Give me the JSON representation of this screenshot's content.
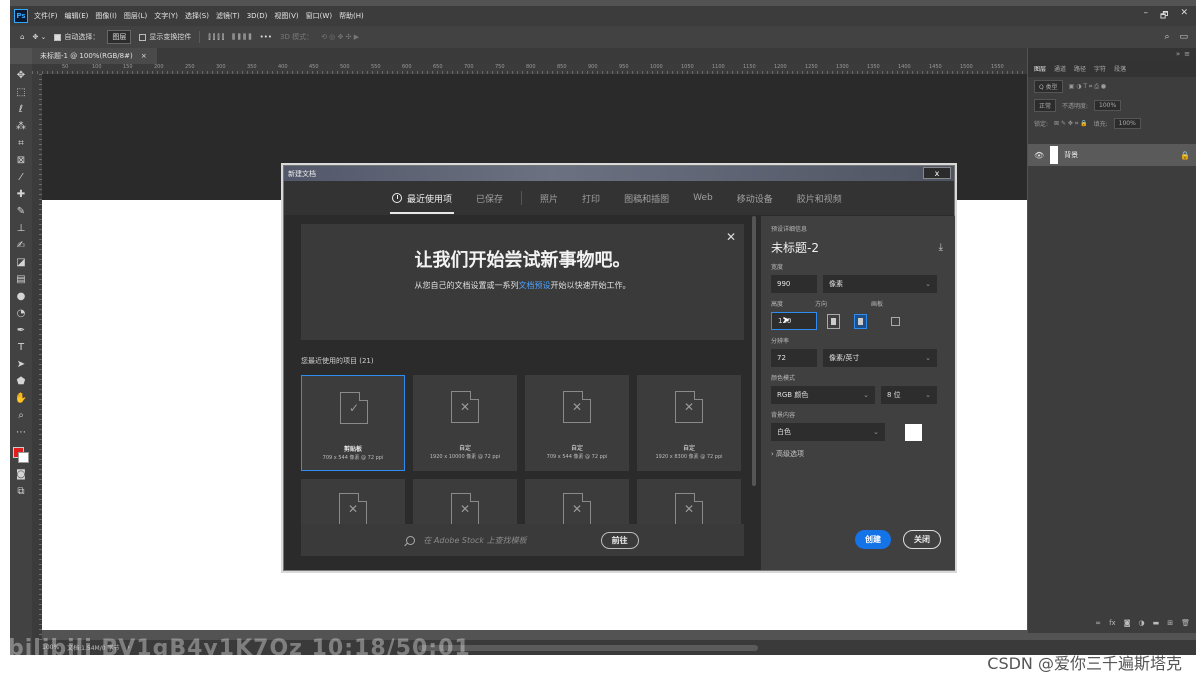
{
  "menubar": {
    "logo": "Ps",
    "items": [
      "文件(F)",
      "编辑(E)",
      "图像(I)",
      "图层(L)",
      "文字(Y)",
      "选择(S)",
      "滤镜(T)",
      "3D(D)",
      "视图(V)",
      "窗口(W)",
      "帮助(H)"
    ],
    "minimize": "–",
    "restore": "🗗",
    "close": "✕"
  },
  "optbar": {
    "auto_select": "自动选择：",
    "layer_select": "图层",
    "show_transform": "显示变换控件",
    "more": "•••",
    "mode_3d": "3D 模式："
  },
  "doc_tab": {
    "label": "未标题-1 @ 100%(RGB/8#)",
    "close": "×"
  },
  "ruler_ticks": [
    "50",
    "100",
    "150",
    "200",
    "250",
    "300",
    "350",
    "400",
    "450",
    "500",
    "550",
    "600",
    "650",
    "700",
    "750",
    "800",
    "850",
    "900",
    "950",
    "1000",
    "1050",
    "1100",
    "1150",
    "1200",
    "1250",
    "1300",
    "1350",
    "1400",
    "1450",
    "1500",
    "1550"
  ],
  "status": {
    "zoom": "100%",
    "doc_info": "文档:1.54M/0 字节"
  },
  "right_panel": {
    "tabs": [
      "图层",
      "通道",
      "路径",
      "字符",
      "段落"
    ],
    "kind": "Q 类型",
    "blend": "正常",
    "opacity_label": "不透明度:",
    "opacity": "100%",
    "lock_label": "锁定:",
    "fill_label": "填充:",
    "fill": "100%",
    "layer_name": "背景"
  },
  "dialog": {
    "title": "新建文档",
    "close": "x",
    "tabs": [
      "最近使用项",
      "已保存",
      "照片",
      "打印",
      "图稿和插图",
      "Web",
      "移动设备",
      "胶片和视频"
    ],
    "hero_title": "让我们开始尝试新事物吧。",
    "hero_sub_pre": "从您自己的文档设置或一系列",
    "hero_sub_link": "文档预设",
    "hero_sub_post": "开始以快速开始工作。",
    "hero_close": "✕",
    "recent_label": "您最近使用的项目 (21)",
    "cards": [
      {
        "name": "剪贴板",
        "spec": "709 x 544 像素 @ 72 ppi",
        "mark": "✓"
      },
      {
        "name": "自定",
        "spec": "1920 x 10000 像素 @ 72 ppi",
        "mark": "✕"
      },
      {
        "name": "自定",
        "spec": "709 x 544 像素 @ 72 ppi",
        "mark": "✕"
      },
      {
        "name": "自定",
        "spec": "1920 x 8300 像素 @ 72 ppi",
        "mark": "✕"
      }
    ],
    "card_mark": "✕",
    "stock_placeholder": "在 Adobe Stock 上查找模板",
    "stock_button": "前往",
    "details": {
      "section": "预设详细信息",
      "name": "未标题-2",
      "width_label": "宽度",
      "width": "990",
      "unit": "像素",
      "height_label": "高度",
      "height": "120",
      "orientation_label": "方向",
      "artboard_label": "画板",
      "resolution_label": "分辨率",
      "resolution": "72",
      "resolution_unit": "像素/英寸",
      "color_mode_label": "颜色模式",
      "color_mode": "RGB 颜色",
      "bit_depth": "8 位",
      "bg_label": "背景内容",
      "bg": "白色",
      "advanced": "高级选项",
      "create": "创建",
      "close": "关闭"
    }
  },
  "watermarks": {
    "bilibili": "bilibili BV1gB4y1K7Qz 10:18/50:01",
    "csdn": "CSDN @爱你三千遍斯塔克"
  }
}
